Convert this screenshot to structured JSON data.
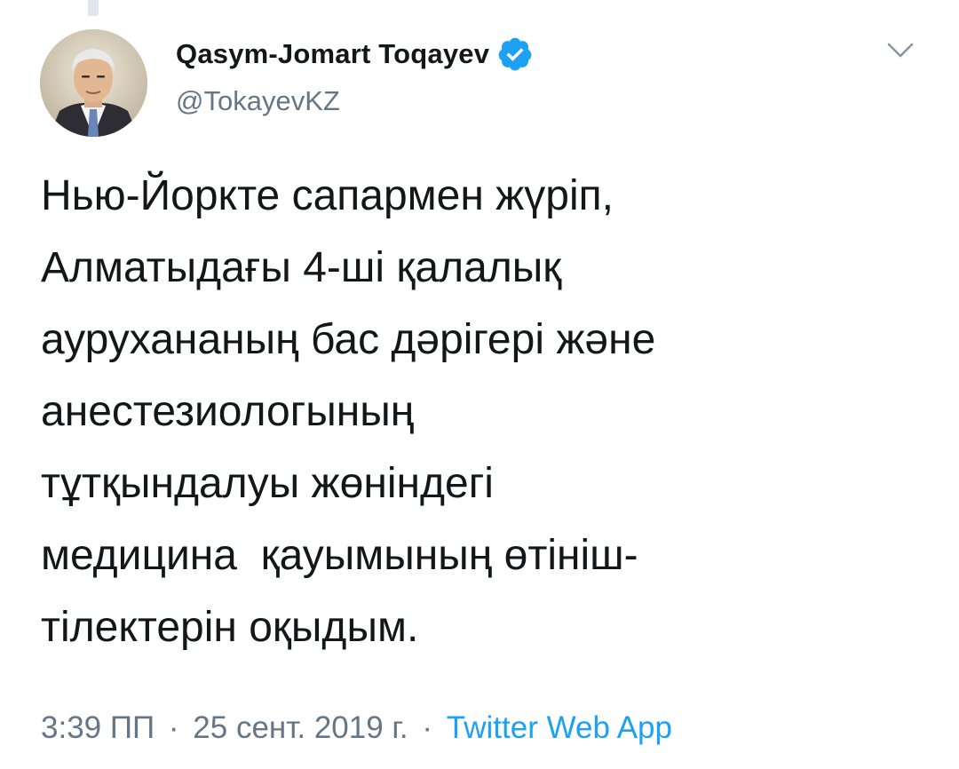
{
  "tweet": {
    "author": {
      "display_name": "Qasym-Jomart Toqayev",
      "handle": "@TokayevKZ",
      "verified": true,
      "avatar_icon": "profile-photo"
    },
    "text": "Нью-Йоркте сапармен жүріп,\nАлматыдағы 4-ші қалалық\nаурухананың бас дәрігері және\nанестезиологының\nтұтқындалуы жөніндегі\nмедицина  қауымының өтініш-\nтілектерін оқыдым.",
    "time": "3:39 ПП",
    "separator": "·",
    "date": "25 сент. 2019 г.",
    "source": "Twitter Web App",
    "menu_icon": "chevron-down-icon"
  },
  "colors": {
    "text": "#14171a",
    "secondary": "#657786",
    "link": "#1da1f2",
    "verified_badge": "#1da1f2",
    "thread_line": "#e1e8ed"
  }
}
